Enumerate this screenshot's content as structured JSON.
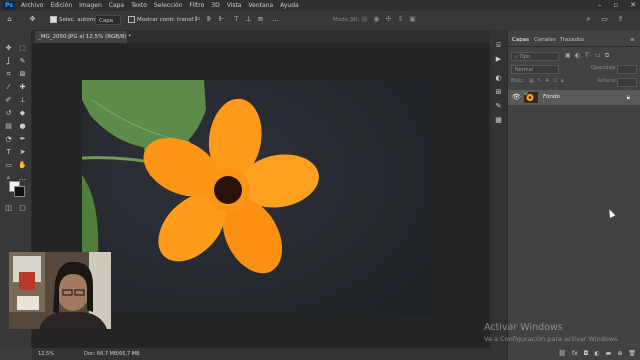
{
  "app": {
    "logo": "Ps"
  },
  "menu": [
    "Archivo",
    "Edición",
    "Imagen",
    "Capa",
    "Texto",
    "Selección",
    "Filtro",
    "3D",
    "Vista",
    "Ventana",
    "Ayuda"
  ],
  "options": {
    "auto_select_label": "Selec. autom.:",
    "layer_select": "Capa",
    "show_transform_label": "Mostrar contr. transf.",
    "mode_3d": "Modo 3D:"
  },
  "document_tab": "_MG_2050.JPG al 12,5% (RGB/8) *",
  "panels": {
    "tabs": [
      "Capas",
      "Canales",
      "Trazados"
    ],
    "search_placeholder": "Tipo",
    "blend_mode": "Normal",
    "opacity_label": "Opacidad:",
    "lock_label": "Bloq.:",
    "fill_label": "Relleno:",
    "layers": [
      {
        "name": "Fondo"
      }
    ]
  },
  "status": {
    "zoom": "12,5%",
    "doc_info": "Doc: 66,7 MB/66,7 MB"
  },
  "watermark": {
    "title": "Activar Windows",
    "subtitle": "Ve a Configuración para activar Windows."
  },
  "colors": {
    "accent": "#31a8ff",
    "flower": "#ff9a1a",
    "flower_center": "#2a1208",
    "leaf": "#4d7f3a"
  },
  "icons": [
    "home-icon",
    "move-icon",
    "marquee-icon",
    "lasso-icon",
    "quick-select-icon",
    "crop-icon",
    "frame-icon",
    "eyedropper-icon",
    "healing-icon",
    "brush-icon",
    "stamp-icon",
    "history-brush-icon",
    "eraser-icon",
    "gradient-icon",
    "blur-icon",
    "dodge-icon",
    "pen-icon",
    "type-icon",
    "path-select-icon",
    "shape-icon",
    "hand-icon",
    "zoom-icon",
    "eye-icon",
    "lock-icon",
    "search-icon",
    "arrange-icon",
    "minimize-icon",
    "maximize-icon",
    "close-icon"
  ]
}
